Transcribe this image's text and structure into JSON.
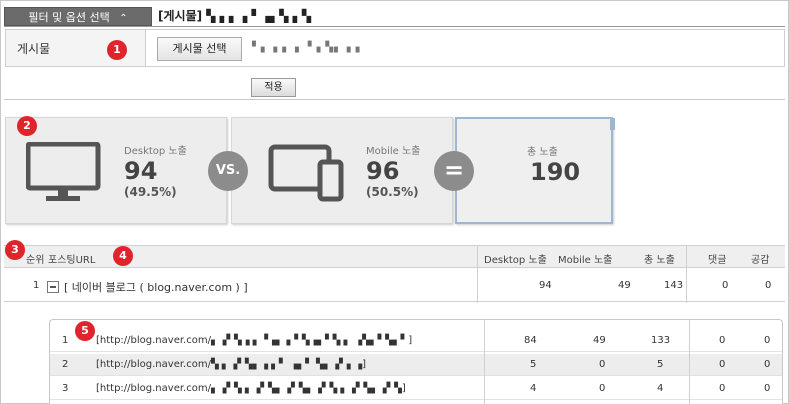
{
  "topbar": {
    "filter_tab_label": "필터 및 옵션 선택",
    "filter_tab_chevron": "⌃",
    "post_title": "[게시물] ▚ ▖▖▗ ▘▗▖▚ ▖▚"
  },
  "filter": {
    "label": "게시물",
    "select_button": "게시물 선택",
    "selected_post": "▘▖▗ ▖▗ ▝ ▖▚▖▗ ▖"
  },
  "apply_button": "적용",
  "markers": [
    "1",
    "2",
    "3",
    "4",
    "5"
  ],
  "stats": {
    "desktop": {
      "title": "Desktop 노출",
      "value": "94",
      "percent": "(49.5%)",
      "icon": "desktop-monitor-icon"
    },
    "mobile": {
      "title": "Mobile 노출",
      "value": "96",
      "percent": "(50.5%)",
      "icon": "tablet-phone-icon"
    },
    "total": {
      "title": "총 노출",
      "value": "190"
    },
    "vs_label": "VS.",
    "equals_label": "="
  },
  "table": {
    "headers": {
      "rank": "순위",
      "url": "포스팅URL",
      "desktop": "Desktop 노출",
      "mobile": "Mobile 노출",
      "total": "총 노출",
      "comments": "댓글",
      "likes": "공감"
    },
    "group_row": {
      "rank": "1",
      "label": "[ 네이버 블로그 ( blog.naver.com ) ]",
      "desktop": "94",
      "mobile": "49",
      "total": "143",
      "comments": "0",
      "likes": "0"
    },
    "sub_rows": [
      {
        "rank": "1",
        "url": "[http://blog.naver.com/▖▗▘▚▗ ▖▝▗▖ ▖▘▚▗▖▘▚ ▖ ▗▚▖▘▚▖▘]",
        "desktop": "84",
        "mobile": "49",
        "total": "133",
        "comments": "0",
        "likes": "0"
      },
      {
        "rank": "2",
        "url": "[http://blog.naver.com/▚ ▖▗▘▚▖▗ ▖▘ ▗▖▘ ▚▖▗▘▖▗]",
        "desktop": "5",
        "mobile": "0",
        "total": "5",
        "comments": "0",
        "likes": "0"
      },
      {
        "rank": "3",
        "url": "[http://blog.naver.com/▖▗▘▚ ▖▗▘▚▖▗▘▚▖▗▘▚ ▖▗▘▚▖▗▘▚]",
        "desktop": "4",
        "mobile": "0",
        "total": "4",
        "comments": "0",
        "likes": "0"
      }
    ]
  }
}
